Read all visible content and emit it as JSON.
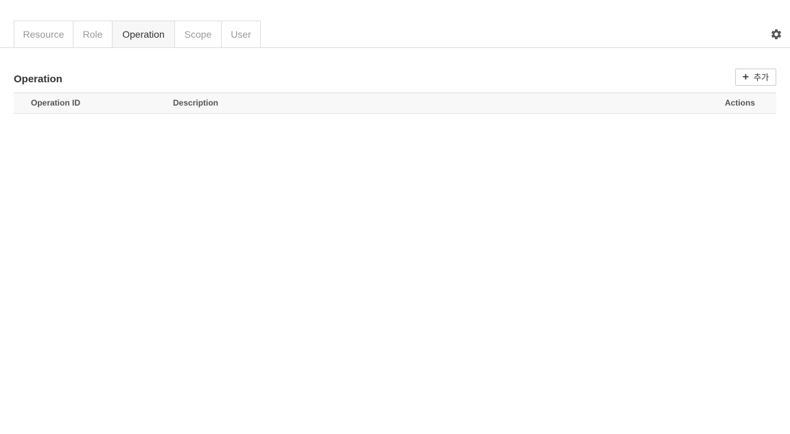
{
  "tabs": [
    {
      "label": "Resource",
      "active": false
    },
    {
      "label": "Role",
      "active": false
    },
    {
      "label": "Operation",
      "active": true
    },
    {
      "label": "Scope",
      "active": false
    },
    {
      "label": "User",
      "active": false
    }
  ],
  "settings_icon": "gear-icon",
  "section": {
    "title": "Operation",
    "add_button_label": "추가",
    "add_button_icon": "plus-icon"
  },
  "table": {
    "columns": [
      "Operation ID",
      "Description",
      "Actions"
    ],
    "rows": []
  },
  "colors": {
    "border": "#dddddd",
    "active_tab_bg": "#f7f7f7",
    "header_bg": "#f8f8f8",
    "inactive_text": "#999999"
  }
}
